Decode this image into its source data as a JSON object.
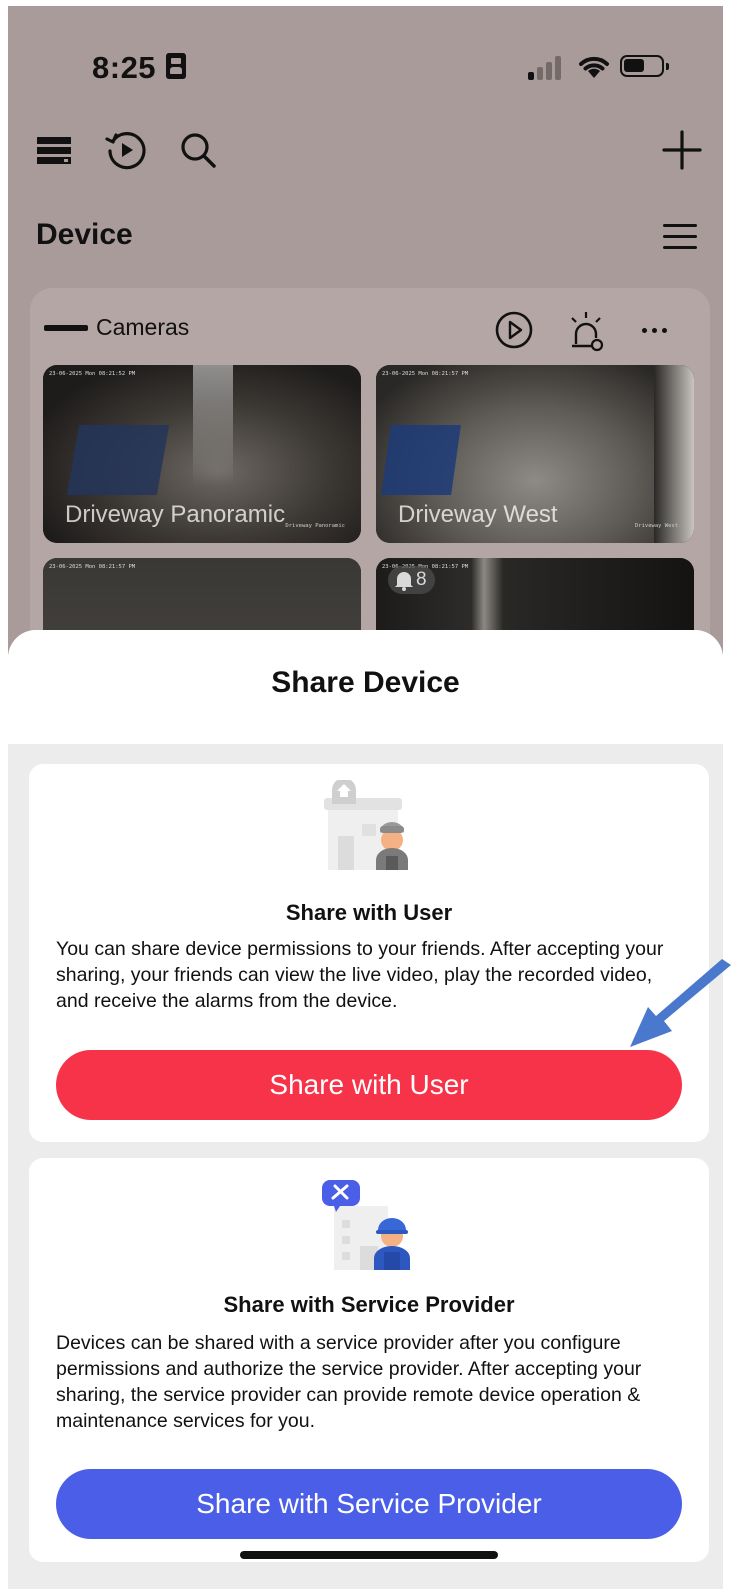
{
  "status_bar": {
    "time": "8:25"
  },
  "toolbar": {
    "icons": [
      "storage-icon",
      "playback-icon",
      "search-icon",
      "add-icon"
    ]
  },
  "device": {
    "title": "Device"
  },
  "cameras": {
    "title": "Cameras",
    "thumbnails": [
      {
        "label": "Driveway Panoramic",
        "timestamp": "23-06-2025 Mon 08:21:52 PM",
        "watermark": "Driveway Panoramic"
      },
      {
        "label": "Driveway West",
        "timestamp": "23-06-2025 Mon 08:21:57 PM",
        "watermark": "Driveway West"
      },
      {
        "label": "",
        "timestamp": "23-06-2025 Mon 08:21:57 PM",
        "watermark": ""
      },
      {
        "label": "",
        "timestamp": "23-06-2025 Mon 08:21:57 PM",
        "watermark": "",
        "alarm_count": "8"
      }
    ]
  },
  "sheet": {
    "title": "Share Device",
    "user_card": {
      "heading": "Share with User",
      "description": "You can share device permissions to your friends. After accepting your sharing, your friends can view the live video, play the recorded video, and receive the alarms from the device.",
      "button": "Share with User"
    },
    "sp_card": {
      "heading": "Share with Service Provider",
      "description": "Devices can be shared with a service provider after you configure permissions and authorize the service provider. After accepting your sharing, the service provider can provide remote device operation & maintenance services for you.",
      "button": "Share with Service Provider"
    }
  },
  "colors": {
    "primary_red": "#f7334a",
    "primary_blue": "#4a5ee8",
    "annotation_arrow": "#4a78cc"
  }
}
